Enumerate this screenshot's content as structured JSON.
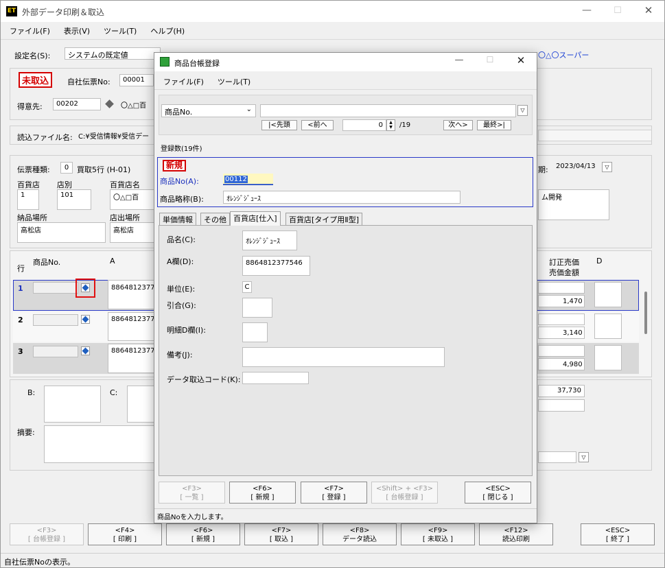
{
  "main": {
    "title": "外部データ印刷＆取込",
    "menu": [
      "ファイル(F)",
      "表示(V)",
      "ツール(T)",
      "ヘルプ(H)"
    ],
    "setting_label": "設定名(S):",
    "setting_value": "システムの既定値",
    "top_right_partial": "〇△〇スーパー",
    "status_badge": "未取込",
    "voucher_label": "自社伝票No:",
    "voucher_value": "00001",
    "customer_label": "得意先:",
    "customer_code": "00202",
    "customer_name": "〇△□百",
    "file_label": "読込ファイル名:",
    "file_value": "C:¥受信情報¥受信デー",
    "slip_type_label": "伝票種類:",
    "slip_type_code": "0",
    "slip_type_name": "買取5行 (H-01)",
    "date_label_partial": "期:",
    "date_value": "2023/04/13",
    "dept_label": "百貨店",
    "dept_value": "1",
    "branch_label": "店別",
    "branch_value": "101",
    "store_label": "百貨店名",
    "store_value": "〇△□百",
    "right_partial": "ム開発",
    "deliver_label": "納品場所",
    "deliver_value": "高松店",
    "ship_label": "店出場所",
    "ship_value": "高松店",
    "col_row": "行",
    "col_item": "商品No.",
    "col_a": "A",
    "col_price1": "訂正売価",
    "col_price2": "売価金額",
    "col_d": "D",
    "rows": [
      {
        "num": "1",
        "code": "8864812377",
        "amount": "1,470"
      },
      {
        "num": "2",
        "code": "8864812377",
        "amount": "3,140"
      },
      {
        "num": "3",
        "code": "8864812377",
        "amount": "4,980"
      }
    ],
    "b_label": "B:",
    "c_label": "C:",
    "total": "37,730",
    "memo_label": "摘要:",
    "fkeys": [
      {
        "key": "<F3>",
        "label": "[ 台帳登録 ]"
      },
      {
        "key": "<F4>",
        "label": "[ 印刷 ]"
      },
      {
        "key": "<F6>",
        "label": "[ 新規 ]"
      },
      {
        "key": "<F7>",
        "label": "[ 取込 ]"
      },
      {
        "key": "<F8>",
        "label": "データ読込"
      },
      {
        "key": "<F9>",
        "label": "[ 未取込 ]"
      },
      {
        "key": "<F12>",
        "label": "読込印刷"
      },
      {
        "key": "<ESC>",
        "label": "[ 終了 ]"
      }
    ],
    "status_bar": "自社伝票Noの表示。"
  },
  "dialog": {
    "title": "商品台帳登録",
    "menu": [
      "ファイル(F)",
      "ツール(T)"
    ],
    "search_field": "商品No.",
    "nav_first": "|<先頭",
    "nav_prev": "<前へ",
    "nav_index": "0",
    "nav_total": "/19",
    "nav_next": "次へ>",
    "nav_last": "最終>|",
    "count": "登録数(19件)",
    "badge": "新規",
    "item_no_label": "商品No(A):",
    "item_no_value": "00112",
    "short_name_label": "商品略称(B):",
    "short_name_value": "ｵﾚﾝｼﾞｼﾞｭｰｽ",
    "tabs": [
      "単価情報",
      "その他",
      "百貨店[仕入]",
      "百貨店[タイプ用Ⅱ型]"
    ],
    "name_label": "品名(C):",
    "name_value": "ｵﾚﾝｼﾞｼﾞｭｰｽ",
    "a_label": "A欄(D):",
    "a_value": "8864812377546",
    "unit_label": "単位(E):",
    "unit_value": "C",
    "pull_label": "引合(G):",
    "detail_label": "明細D欄(I):",
    "note_label": "備考(J):",
    "import_label": "データ取込コード(K):",
    "fkeys": [
      {
        "key": "<F3>",
        "label": "[ 一覧 ]"
      },
      {
        "key": "<F6>",
        "label": "[ 新規 ]"
      },
      {
        "key": "<F7>",
        "label": "[ 登録 ]"
      },
      {
        "key": "<Shift> + <F3>",
        "label": "[ 台帳登録 ]"
      },
      {
        "key": "<ESC>",
        "label": "[ 閉じる ]"
      }
    ],
    "status_bar": "商品Noを入力します。"
  }
}
